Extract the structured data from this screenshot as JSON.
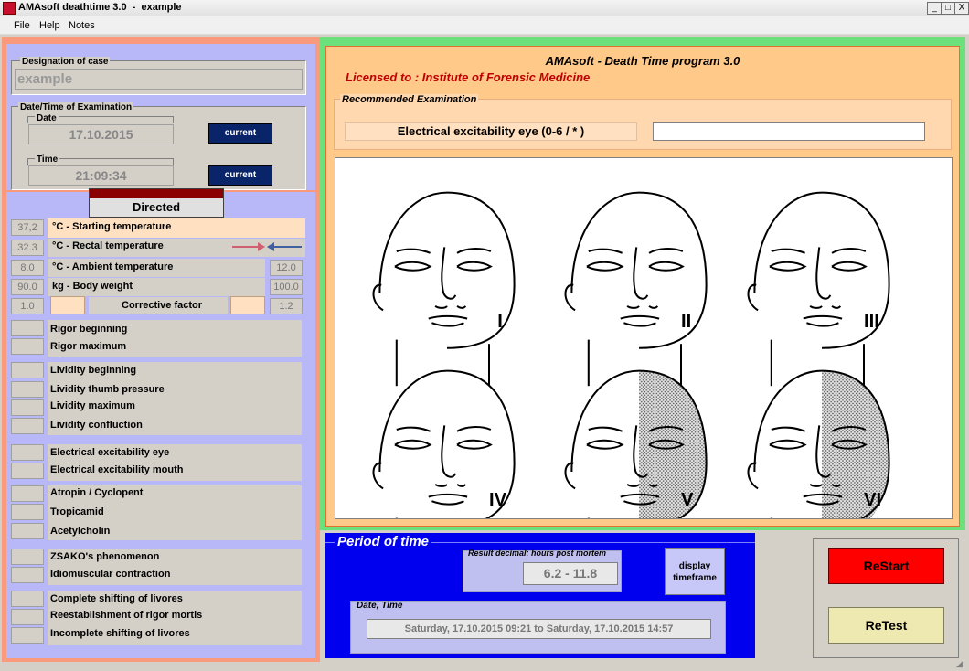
{
  "window": {
    "title": "AMAsoft deathtime 3.0  -  example",
    "minimize": "_",
    "maximize": "□",
    "close": "X"
  },
  "menu": [
    "File",
    "Help",
    "Notes"
  ],
  "case": {
    "legend": "Designation of case",
    "value": "example"
  },
  "datetime": {
    "legend": "Date/Time of Examination",
    "date_legend": "Date",
    "date_value": "17.10.2015",
    "time_legend": "Time",
    "time_value": "21:09:34",
    "current_label": "current"
  },
  "mode": {
    "label": "Directed"
  },
  "params": {
    "starting": {
      "value": "37,2",
      "label": "°C - Starting temperature"
    },
    "rectal": {
      "value": "32.3",
      "label": "°C - Rectal temperature"
    },
    "ambient": {
      "value": "8.0",
      "label": "°C - Ambient temperature",
      "right": "12.0"
    },
    "weight": {
      "value": "90.0",
      "label": "kg - Body weight",
      "right": "100.0"
    },
    "corrective": {
      "value": "1.0",
      "label": "Corrective factor",
      "right": "1.2"
    }
  },
  "groups": {
    "rigor": [
      "Rigor beginning",
      "Rigor maximum"
    ],
    "lividity": [
      "Lividity beginning",
      "Lividity thumb pressure",
      "Lividity maximum",
      "Lividity confluction"
    ],
    "electrical": [
      "Electrical excitability eye",
      "Electrical excitability mouth"
    ],
    "drugs": [
      "Atropin / Cyclopent",
      "Tropicamid",
      "Acetylcholin"
    ],
    "mech": [
      "ZSAKO's phenomenon",
      "Idiomuscular contraction"
    ],
    "livores": [
      "Complete shifting of livores",
      "Reestablishment of rigor mortis",
      "Incomplete shifting of livores"
    ]
  },
  "header": {
    "title": "AMAsoft - Death Time program 3.0",
    "license": "Licensed to : Institute of Forensic Medicine"
  },
  "recommended": {
    "legend": "Recommended Examination",
    "label": "Electrical excitability eye (0-6 / * )",
    "input_value": ""
  },
  "faces": [
    "I",
    "II",
    "III",
    "IV",
    "V",
    "VI"
  ],
  "period": {
    "title": "Period of time",
    "result_legend": "Result decimal: hours post mortem",
    "result_value": "6.2 -  11.8",
    "display_btn": "display timeframe",
    "dt_legend": "Date, Time",
    "dt_value": "Saturday, 17.10.2015 09:21 to Saturday, 17.10.2015 14:57"
  },
  "actions": {
    "restart": "ReStart",
    "retest": "ReTest"
  },
  "colors": {
    "restart": "#ff0000",
    "retest": "#eee9b0",
    "period_bg": "#0000ee",
    "left_border": "#fa9a7d",
    "right_border": "#6ce07a"
  }
}
